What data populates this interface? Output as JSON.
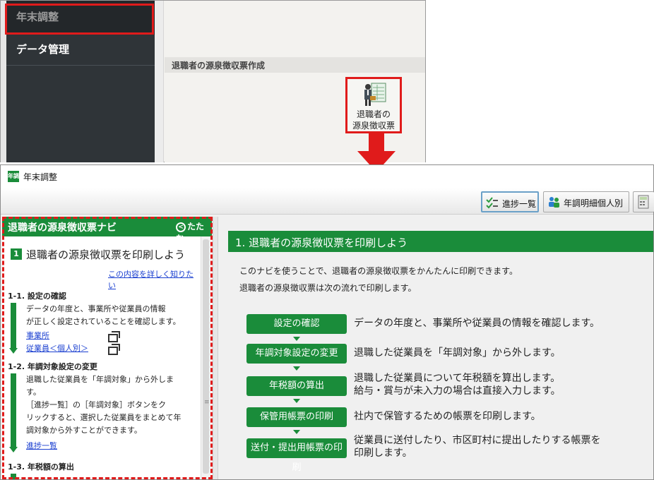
{
  "top": {
    "nav_active": "年末調整",
    "nav_item": "データ管理",
    "section_header": "退職者の源泉徴収票作成",
    "tile_label_line1": "退職者の",
    "tile_label_line2": "源泉徴収票"
  },
  "window": {
    "title": "年末調整",
    "app_icon_text": "年調",
    "toolbar": {
      "progress_label": "進捗一覧",
      "nencho_label": "年調明細個人別"
    }
  },
  "navi": {
    "title": "退職者の源泉徴収票ナビ",
    "fold_label": "たたむ",
    "step_number": "1",
    "step_title": "退職者の源泉徴収票を印刷しよう",
    "more_link": "この内容を詳しく知りたい",
    "sec1": {
      "heading": "1-1. 設定の確認",
      "line1": "データの年度と、事業所や従業員の情報",
      "line2": "が正しく設定されていることを確認します。",
      "link1": "事業所",
      "link2": "従業員＜個人別＞"
    },
    "sec2": {
      "heading": "1-2. 年調対象設定の変更",
      "line1": "退職した従業員を「年調対象」から外しま",
      "line2": "す。",
      "line3": "［進捗一覧］の［年調対象］ボタンをク",
      "line4": "リックすると、選択した従業員をまとめて年",
      "line5": "調対象から外すことができます。",
      "link1": "進捗一覧"
    },
    "sec3": {
      "heading": "1-3. 年税額の算出"
    }
  },
  "main": {
    "header": "1. 退職者の源泉徴収票を印刷しよう",
    "intro1": "このナビを使うことで、退職者の源泉徴収票をかんたんに印刷できます。",
    "intro2": "退職者の源泉徴収票は次の流れで印刷します。",
    "flow": [
      {
        "label": "設定の確認",
        "desc1": "データの年度と、事業所や従業員の情報を確認します。",
        "desc2": ""
      },
      {
        "label": "年調対象設定の変更",
        "desc1": "退職した従業員を「年調対象」から外します。",
        "desc2": ""
      },
      {
        "label": "年税額の算出",
        "desc1": "退職した従業員について年税額を算出します。",
        "desc2": "給与・賞与が未入力の場合は直接入力します。"
      },
      {
        "label": "保管用帳票の印刷",
        "desc1": "社内で保管するための帳票を印刷します。",
        "desc2": ""
      },
      {
        "label": "送付・提出用帳票の印刷",
        "desc1": "従業員に送付したり、市区町村に提出したりする帳票を",
        "desc2": "印刷します。"
      }
    ]
  },
  "colors": {
    "accent_green": "#1a8c3a",
    "highlight_red": "#e01b1b",
    "link_blue": "#1a3fd0",
    "sidebar_dark": "#2f3438"
  }
}
